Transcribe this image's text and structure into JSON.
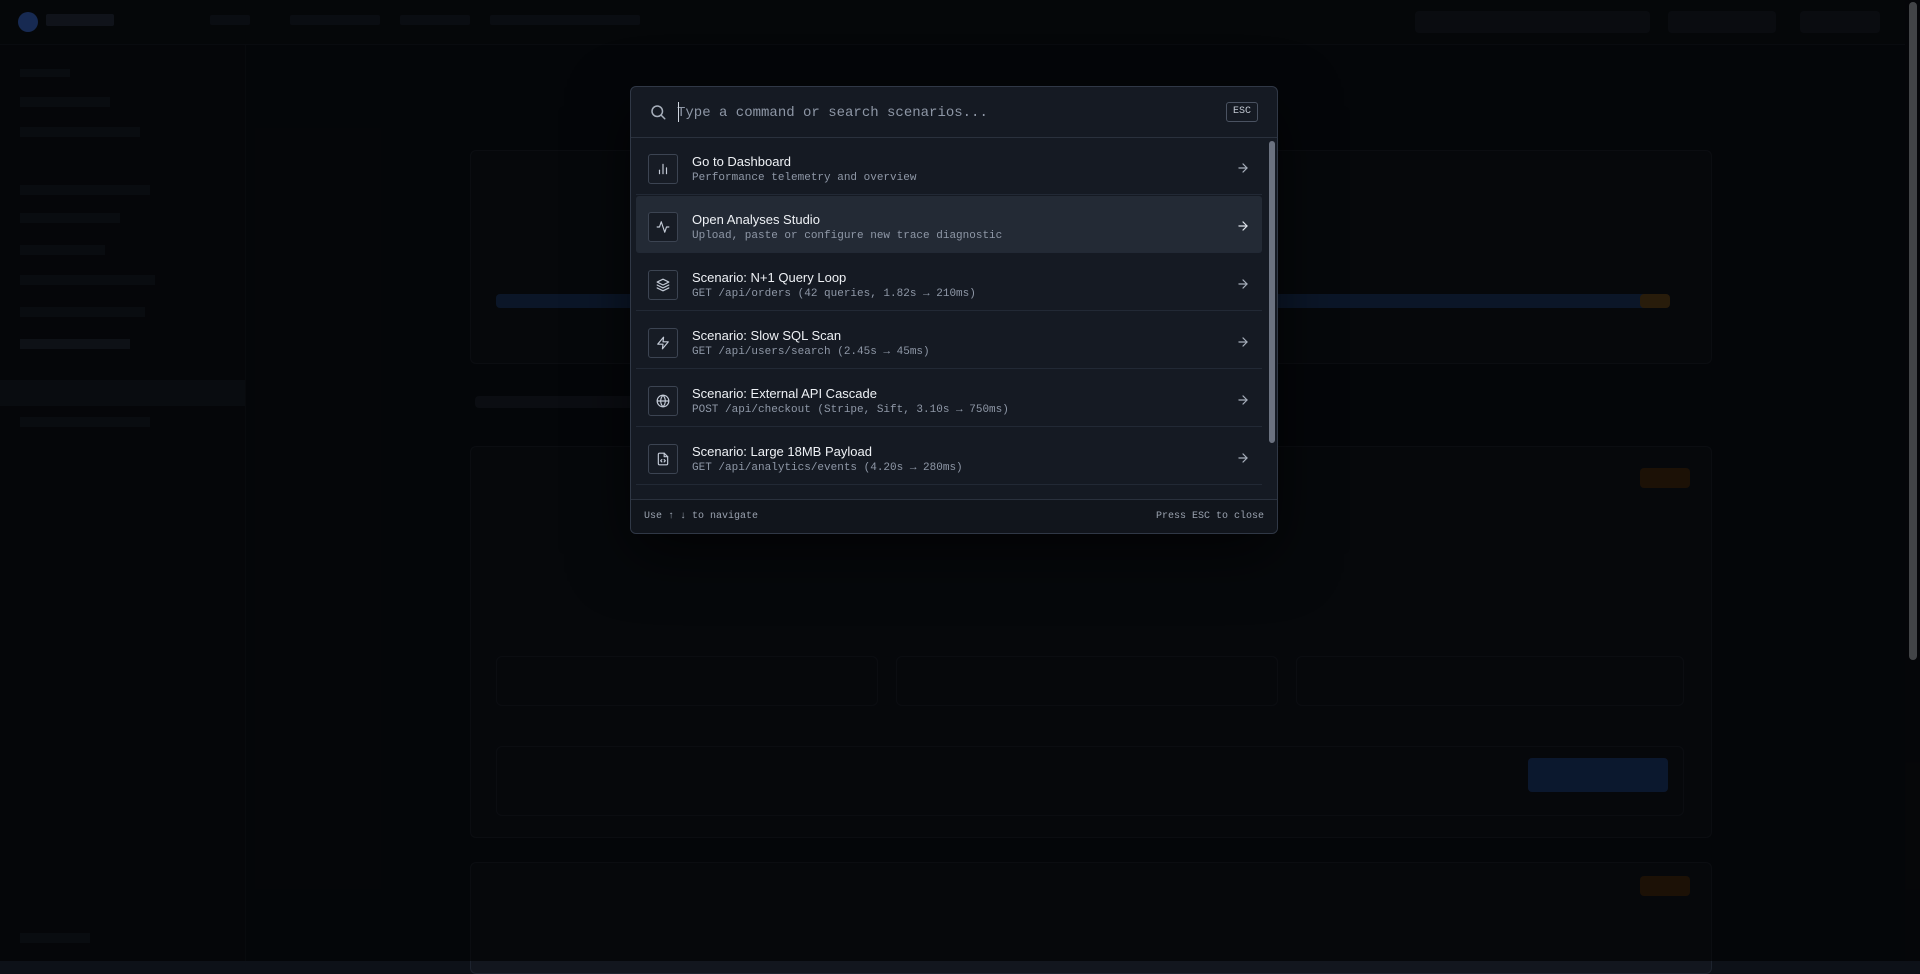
{
  "search": {
    "placeholder": "Type a command or search scenarios...",
    "esc_label": "ESC"
  },
  "items": [
    {
      "title": "Go to Dashboard",
      "subtitle": "Performance telemetry and overview",
      "icon": "bar-chart-icon"
    },
    {
      "title": "Open Analyses Studio",
      "subtitle": "Upload, paste or configure new trace diagnostic",
      "icon": "activity-icon"
    },
    {
      "title": "Scenario: N+1 Query Loop",
      "subtitle": "GET /api/orders (42 queries, 1.82s → 210ms)",
      "icon": "layers-icon"
    },
    {
      "title": "Scenario: Slow SQL Scan",
      "subtitle": "GET /api/users/search (2.45s → 45ms)",
      "icon": "zap-icon"
    },
    {
      "title": "Scenario: External API Cascade",
      "subtitle": "POST /api/checkout (Stripe, Sift, 3.10s → 750ms)",
      "icon": "globe-icon"
    },
    {
      "title": "Scenario: Large 18MB Payload",
      "subtitle": "GET /api/analytics/events (4.20s → 280ms)",
      "icon": "file-code-icon"
    }
  ],
  "footer": {
    "hint_left": "Use ↑ ↓ to navigate",
    "hint_right": "Press ESC to close"
  },
  "colors": {
    "overlay": "#000000",
    "palette_bg": "#151a23",
    "active_row": "#232a35",
    "accent": "#3d6fd8"
  }
}
